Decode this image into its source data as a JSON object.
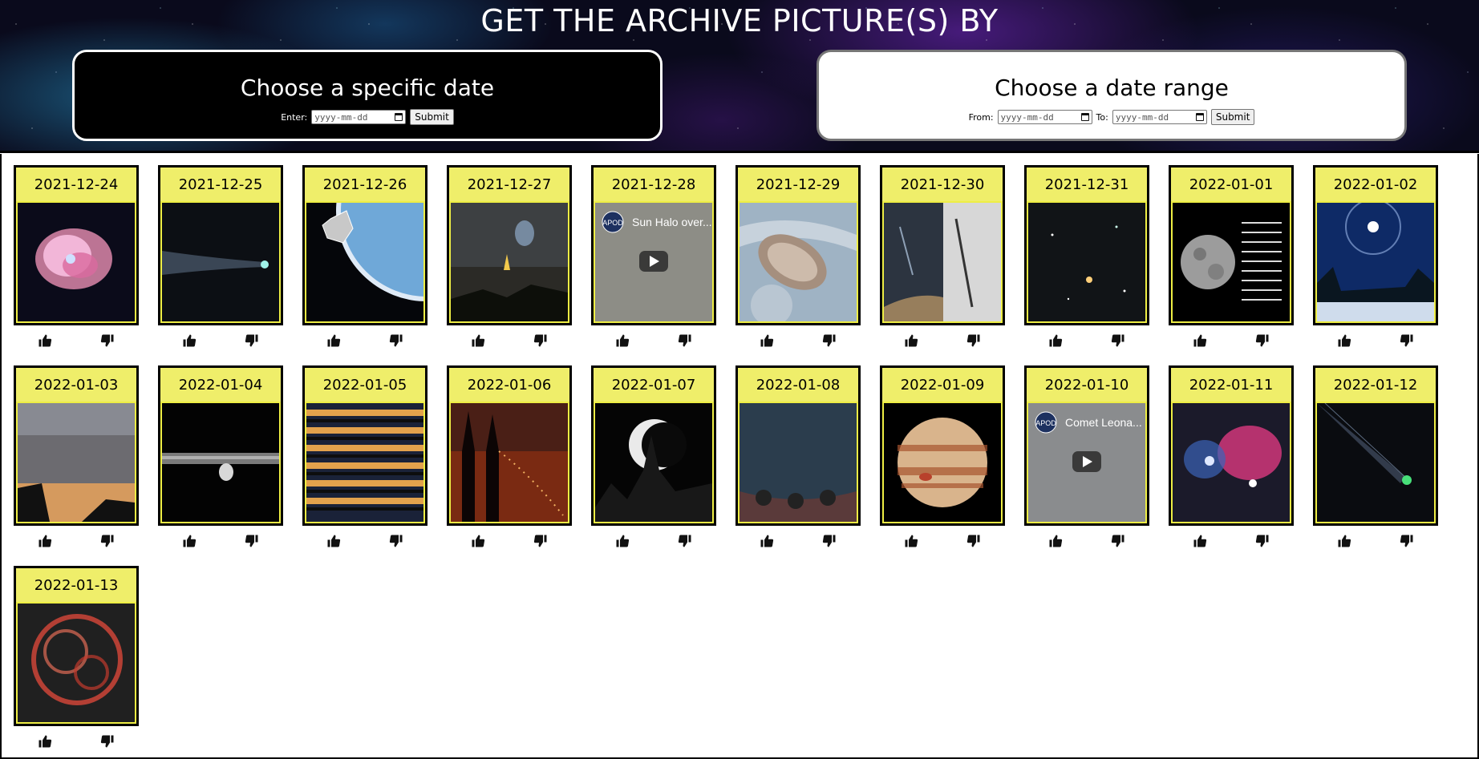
{
  "header": {
    "title": "GET THE ARCHIVE PICTURE(S) BY",
    "specific": {
      "title": "Choose a specific date",
      "label": "Enter:",
      "placeholder": "yyyy-mm-dd",
      "submit": "Submit"
    },
    "range": {
      "title": "Choose a date range",
      "from_label": "From:",
      "to_label": "To:",
      "placeholder": "yyyy-mm-dd",
      "submit": "Submit"
    }
  },
  "cards": [
    {
      "date": "2021-12-24",
      "thumb": "crab-nebula"
    },
    {
      "date": "2021-12-25",
      "thumb": "comet-tail"
    },
    {
      "date": "2021-12-26",
      "thumb": "webb-telescope-earth"
    },
    {
      "date": "2021-12-27",
      "thumb": "spiral-over-church"
    },
    {
      "date": "2021-12-28",
      "thumb": "video",
      "video_title": "Sun Halo over..."
    },
    {
      "date": "2021-12-29",
      "thumb": "jupiter-storm"
    },
    {
      "date": "2021-12-30",
      "thumb": "comet-comparison"
    },
    {
      "date": "2021-12-31",
      "thumb": "star-field"
    },
    {
      "date": "2022-01-01",
      "thumb": "moon-chart"
    },
    {
      "date": "2022-01-02",
      "thumb": "winter-halo"
    },
    {
      "date": "2022-01-03",
      "thumb": "twilight-sky"
    },
    {
      "date": "2022-01-04",
      "thumb": "saturn-rings-moon"
    },
    {
      "date": "2022-01-05",
      "thumb": "sunset-strips"
    },
    {
      "date": "2022-01-06",
      "thumb": "church-spires"
    },
    {
      "date": "2022-01-07",
      "thumb": "eclipse-silhouette"
    },
    {
      "date": "2022-01-08",
      "thumb": "antennas-sky"
    },
    {
      "date": "2022-01-09",
      "thumb": "jupiter"
    },
    {
      "date": "2022-01-10",
      "thumb": "video",
      "video_title": "Comet Leona..."
    },
    {
      "date": "2022-01-11",
      "thumb": "pink-nebula"
    },
    {
      "date": "2022-01-12",
      "thumb": "green-comet"
    },
    {
      "date": "2022-01-13",
      "thumb": "red-supernova-remnant"
    }
  ],
  "icons": {
    "like": "thumbs-up-icon",
    "dislike": "thumbs-down-icon"
  }
}
